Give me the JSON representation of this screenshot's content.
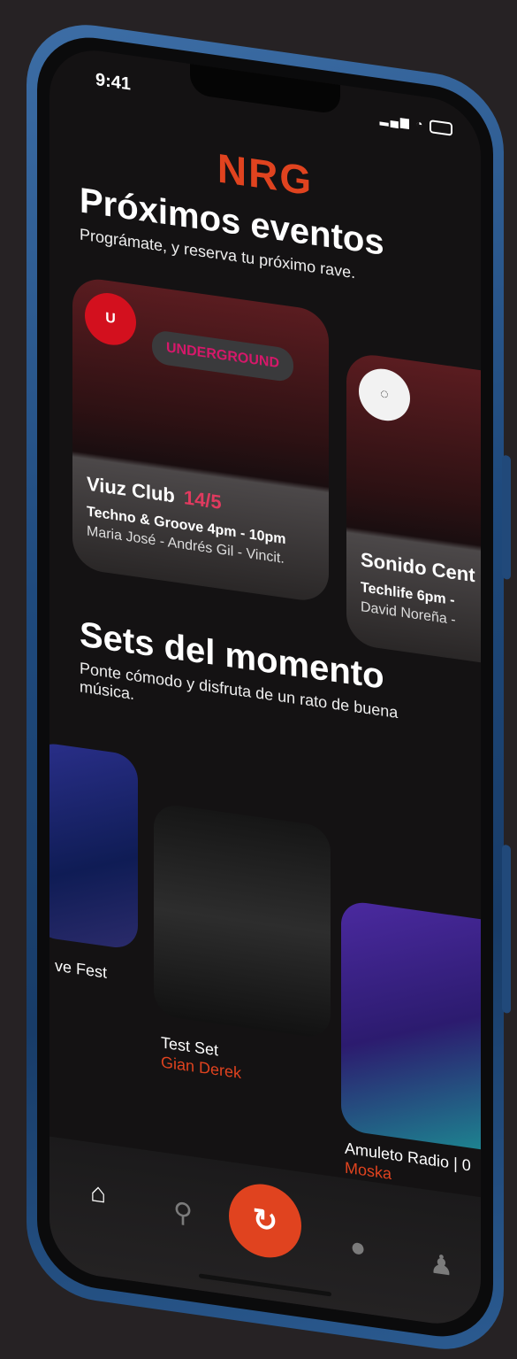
{
  "status": {
    "time": "9:41"
  },
  "brand": {
    "logo": "NRG"
  },
  "upcoming": {
    "title": "Próximos eventos",
    "subtitle": "Prográmate, y reserva tu próximo rave.",
    "events": [
      {
        "badge_icon": "viuz-logo-icon",
        "chip": "UNDERGROUND",
        "name": "Viuz Club",
        "date": "14/5",
        "line1": "Techno & Groove 4pm - 10pm",
        "line2": "Maria José - Andrés Gil - Vincit."
      },
      {
        "badge_icon": "sonido-logo-icon",
        "name": "Sonido Cent",
        "line1": "Techlife 6pm -",
        "line2": "David Noreña -"
      }
    ]
  },
  "sets": {
    "title": "Sets del momento",
    "subtitle": "Ponte cómodo y disfruta de un rato de buena música.",
    "items": [
      {
        "title": "ve Fest",
        "artist": ""
      },
      {
        "title": "Test Set",
        "artist": "Gian Derek"
      },
      {
        "title": "Amuleto Radio | 0",
        "artist": "Moska"
      }
    ]
  },
  "tabbar": {
    "home_icon": "home-icon",
    "search_icon": "search-icon",
    "center_icon": "nrg-icon",
    "chat_icon": "chat-icon",
    "profile_icon": "profile-icon"
  },
  "colors": {
    "accent": "#e0431f",
    "date": "#e03a5f",
    "chip_text": "#d6186a"
  }
}
